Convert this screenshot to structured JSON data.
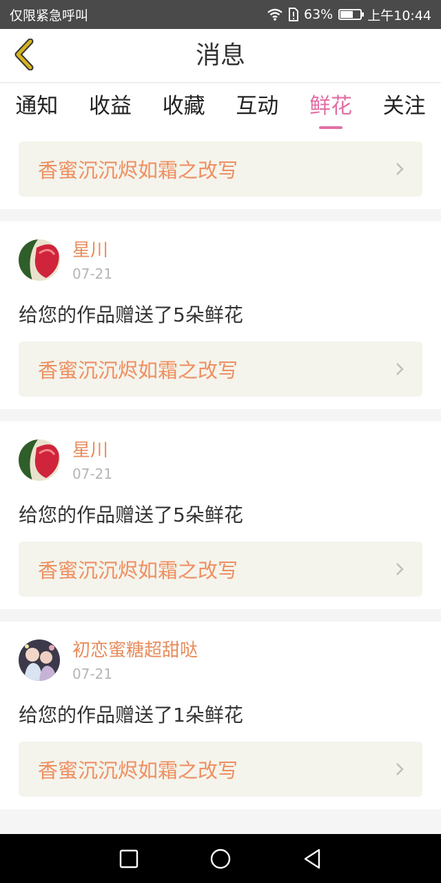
{
  "status_bar": {
    "carrier": "仅限紧急呼叫",
    "battery": "63%",
    "battery_level": 0.63,
    "time": "上午10:44"
  },
  "header": {
    "title": "消息",
    "back_icon": "chevron-left-icon"
  },
  "tabs": [
    {
      "label": "通知",
      "active": false
    },
    {
      "label": "收益",
      "active": false
    },
    {
      "label": "收藏",
      "active": false
    },
    {
      "label": "互动",
      "active": false
    },
    {
      "label": "鲜花",
      "active": true
    },
    {
      "label": "关注",
      "active": false
    }
  ],
  "top_card": {
    "work_title": "香蜜沉沉烬如霜之改写"
  },
  "messages": [
    {
      "name": "星川",
      "date": "07-21",
      "text": "给您的作品赠送了5朵鲜花",
      "work_title": "香蜜沉沉烬如霜之改写"
    },
    {
      "name": "星川",
      "date": "07-21",
      "text": "给您的作品赠送了5朵鲜花",
      "work_title": "香蜜沉沉烬如霜之改写"
    },
    {
      "name": "初恋蜜糖超甜哒",
      "date": "07-21",
      "text": "给您的作品赠送了1朵鲜花",
      "work_title": "香蜜沉沉烬如霜之改写"
    }
  ],
  "colors": {
    "accent_pink": "#e26fa5",
    "orange_text": "#ef8e5f",
    "back_arrow": "#c9a81a",
    "work_box_bg": "#f4f4ec"
  },
  "nav_bar": {
    "icons": [
      "square-icon",
      "circle-icon",
      "triangle-back-icon"
    ]
  }
}
